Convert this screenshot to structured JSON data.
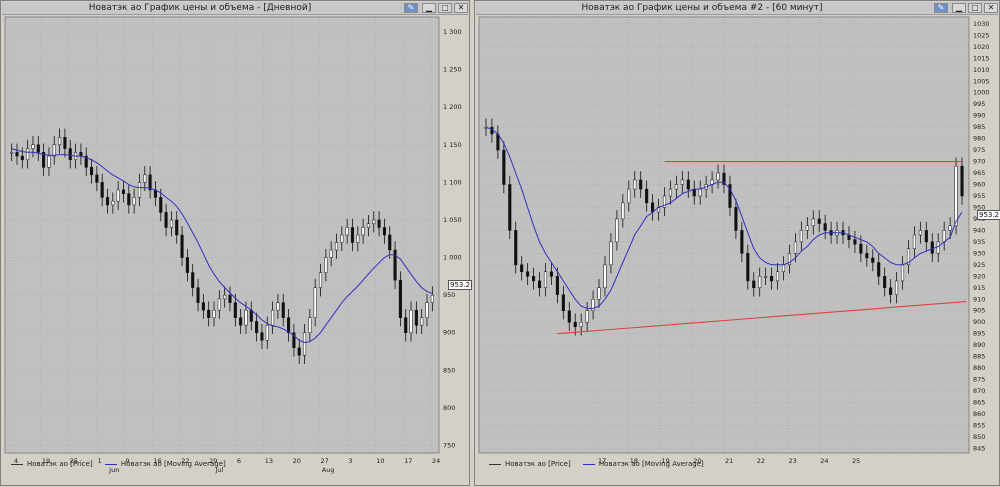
{
  "left_window": {
    "title": "Новатэк ао График цены и объема - [Дневной]",
    "price_badge": "953.2",
    "legend": [
      {
        "label": "Новатэк ао [Price]",
        "color": "#333333"
      },
      {
        "label": "Новатэк ао [Moving Average]",
        "color": "#3030c0"
      }
    ],
    "y_ticks": [
      "1 300",
      "1 250",
      "1 200",
      "1 150",
      "1 100",
      "1 050",
      "1 000",
      "950",
      "900",
      "850",
      "800",
      "750"
    ],
    "x_ticks": [
      "4",
      "19",
      "25",
      "1",
      "9",
      "16",
      "22",
      "29",
      "6",
      "13",
      "20",
      "27",
      "3",
      "10",
      "17",
      "24"
    ],
    "month_labels": [
      "Jun",
      "Jul",
      "Aug"
    ]
  },
  "right_window": {
    "title": "Новатэк ао График цены и объема #2 - [60 минут]",
    "price_badge": "953.2",
    "legend": [
      {
        "label": "Новатэк ао [Price]",
        "color": "#333333"
      },
      {
        "label": "Новатэк ао [Moving Average]",
        "color": "#3030c0"
      }
    ],
    "y_ticks": [
      "1030",
      "1025",
      "1020",
      "1015",
      "1010",
      "1005",
      "1000",
      "995",
      "990",
      "985",
      "980",
      "975",
      "970",
      "965",
      "960",
      "955",
      "950",
      "945",
      "940",
      "935",
      "930",
      "925",
      "920",
      "915",
      "910",
      "905",
      "900",
      "895",
      "890",
      "885",
      "880",
      "875",
      "870",
      "865",
      "860",
      "855",
      "850",
      "845"
    ],
    "x_ticks": [
      "17",
      "18",
      "19",
      "20",
      "21",
      "22",
      "23",
      "24",
      "25"
    ]
  },
  "chart_data": [
    {
      "type": "candlestick",
      "title": "Новатэк ао График цены и объема - [Дневной]",
      "ylim": [
        740,
        1320
      ],
      "series": [
        {
          "name": "Новатэк ао [Price]",
          "values": [
            1140,
            1135,
            1130,
            1145,
            1150,
            1140,
            1120,
            1135,
            1150,
            1160,
            1145,
            1130,
            1140,
            1135,
            1120,
            1110,
            1100,
            1080,
            1070,
            1075,
            1090,
            1085,
            1070,
            1080,
            1100,
            1110,
            1090,
            1080,
            1060,
            1040,
            1050,
            1030,
            1000,
            980,
            960,
            940,
            930,
            920,
            930,
            945,
            950,
            940,
            920,
            910,
            930,
            915,
            900,
            890,
            910,
            930,
            940,
            920,
            900,
            880,
            870,
            900,
            920,
            960,
            980,
            1000,
            1010,
            1020,
            1030,
            1040,
            1020,
            1030,
            1040,
            1045,
            1050,
            1040,
            1030,
            1010,
            970,
            920,
            900,
            930,
            910,
            920,
            940,
            950
          ]
        },
        {
          "name": "Новатэк ао [Moving Average]",
          "values": [
            1145,
            1143,
            1141,
            1140,
            1140,
            1139,
            1137,
            1136,
            1136,
            1137,
            1137,
            1136,
            1135,
            1135,
            1133,
            1130,
            1126,
            1121,
            1115,
            1110,
            1106,
            1102,
            1097,
            1094,
            1093,
            1093,
            1092,
            1090,
            1086,
            1080,
            1075,
            1068,
            1058,
            1046,
            1033,
            1020,
            1005,
            990,
            978,
            968,
            960,
            953,
            946,
            940,
            935,
            930,
            924,
            917,
            912,
            909,
            908,
            905,
            901,
            896,
            890,
            887,
            888,
            893,
            900,
            910,
            920,
            930,
            940,
            948,
            955,
            962,
            970,
            978,
            986,
            993,
            1000,
            1004,
            1003,
            998,
            988,
            978,
            968,
            960,
            955,
            952
          ]
        }
      ]
    },
    {
      "type": "candlestick",
      "title": "Новатэк ао График цены и объема #2 - [60 минут]",
      "ylim": [
        843,
        1033
      ],
      "series": [
        {
          "name": "Новатэк ао [Price]",
          "values": [
            985,
            982,
            975,
            960,
            940,
            925,
            922,
            920,
            918,
            915,
            922,
            920,
            912,
            905,
            900,
            898,
            900,
            905,
            910,
            915,
            925,
            935,
            945,
            952,
            958,
            962,
            958,
            952,
            948,
            950,
            955,
            958,
            960,
            962,
            958,
            955,
            958,
            960,
            962,
            965,
            960,
            950,
            940,
            930,
            918,
            915,
            920,
            920,
            918,
            922,
            925,
            930,
            935,
            940,
            942,
            945,
            943,
            940,
            938,
            940,
            938,
            936,
            934,
            930,
            928,
            926,
            920,
            915,
            912,
            918,
            925,
            932,
            938,
            940,
            935,
            930,
            935,
            940,
            942,
            968,
            955
          ]
        },
        {
          "name": "Новатэк ао [Moving Average]",
          "values": [
            985,
            984,
            982,
            978,
            972,
            965,
            958,
            950,
            942,
            935,
            930,
            926,
            922,
            918,
            914,
            910,
            907,
            906,
            906,
            907,
            910,
            914,
            920,
            926,
            932,
            938,
            942,
            946,
            948,
            950,
            951,
            952,
            954,
            956,
            957,
            958,
            958,
            959,
            960,
            961,
            961,
            958,
            953,
            946,
            939,
            932,
            928,
            926,
            925,
            925,
            925,
            926,
            928,
            931,
            933,
            936,
            938,
            939,
            939,
            939,
            939,
            938,
            937,
            936,
            935,
            933,
            930,
            928,
            926,
            925,
            925,
            926,
            928,
            930,
            931,
            932,
            933,
            935,
            937,
            944,
            948
          ]
        }
      ]
    }
  ]
}
